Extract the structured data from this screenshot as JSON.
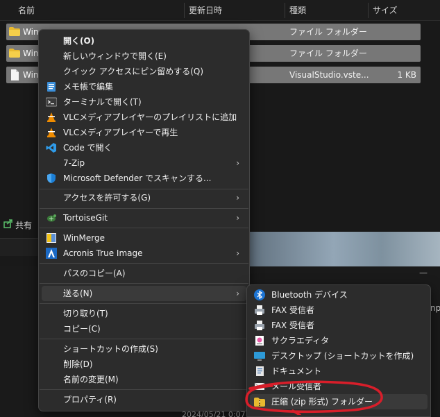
{
  "header": {
    "columns": [
      "名前",
      "更新日時",
      "種類",
      "サイズ"
    ],
    "sort_glyph": "^"
  },
  "files": [
    {
      "name": "Win",
      "type": "ファイル フォルダー",
      "size": "",
      "icon": "folder-icon"
    },
    {
      "name": "Win",
      "type": "ファイル フォルダー",
      "size": "",
      "icon": "folder-icon"
    },
    {
      "name": "Win",
      "type": "VisualStudio.vste...",
      "size": "1 KB",
      "icon": "file-icon"
    }
  ],
  "background": {
    "share_label": "共有",
    "right_dash": "—",
    "peek_text": "npl",
    "bottom_text": "2024/05/21 0:07"
  },
  "menu": {
    "items": [
      {
        "label": "開く(O)",
        "bold": true,
        "icon": ""
      },
      {
        "label": "新しいウィンドウで開く(E)",
        "icon": ""
      },
      {
        "label": "クイック アクセスにピン留めする(Q)",
        "icon": ""
      },
      {
        "label": "メモ帳で編集",
        "icon": "notepad-icon"
      },
      {
        "label": "ターミナルで開く(T)",
        "icon": "terminal-icon"
      },
      {
        "label": "VLCメディアプレイヤーのプレイリストに追加",
        "icon": "vlc-icon"
      },
      {
        "label": "VLCメディアプレイヤーで再生",
        "icon": "vlc-icon"
      },
      {
        "label": "Code で開く",
        "icon": "vscode-icon"
      },
      {
        "label": "7-Zip",
        "icon": "",
        "submenu": true
      },
      {
        "label": "Microsoft Defender でスキャンする...",
        "icon": "defender-shield-icon"
      },
      {
        "label": "アクセスを許可する(G)",
        "icon": "",
        "submenu": true
      },
      {
        "label": "TortoiseGit",
        "icon": "tortoisegit-icon",
        "submenu": true
      },
      {
        "label": "WinMerge",
        "icon": "winmerge-icon"
      },
      {
        "label": "Acronis True Image",
        "icon": "acronis-icon",
        "submenu": true
      },
      {
        "label": "パスのコピー(A)",
        "icon": ""
      },
      {
        "label": "送る(N)",
        "icon": "",
        "submenu": true
      },
      {
        "label": "切り取り(T)",
        "icon": ""
      },
      {
        "label": "コピー(C)",
        "icon": ""
      },
      {
        "label": "ショートカットの作成(S)",
        "icon": ""
      },
      {
        "label": "削除(D)",
        "icon": ""
      },
      {
        "label": "名前の変更(M)",
        "icon": ""
      },
      {
        "label": "プロパティ(R)",
        "icon": ""
      }
    ],
    "submenu_arrow": "›"
  },
  "sendto": {
    "items": [
      {
        "label": "Bluetooth デバイス",
        "icon": "bluetooth-icon"
      },
      {
        "label": "FAX 受信者",
        "icon": "fax-icon"
      },
      {
        "label": "FAX 受信者",
        "icon": "fax-icon"
      },
      {
        "label": "サクラエディタ",
        "icon": "sakura-editor-icon"
      },
      {
        "label": "デスクトップ (ショートカットを作成)",
        "icon": "desktop-icon"
      },
      {
        "label": "ドキュメント",
        "icon": "documents-icon"
      },
      {
        "label": "メール受信者",
        "icon": "mail-icon"
      },
      {
        "label": "圧縮 (zip 形式) フォルダー",
        "icon": "zip-folder-icon"
      }
    ]
  },
  "colors": {
    "accent_annotation": "#d81e2a",
    "menu_bg": "#2c2c2c",
    "row_selected": "#777777"
  }
}
